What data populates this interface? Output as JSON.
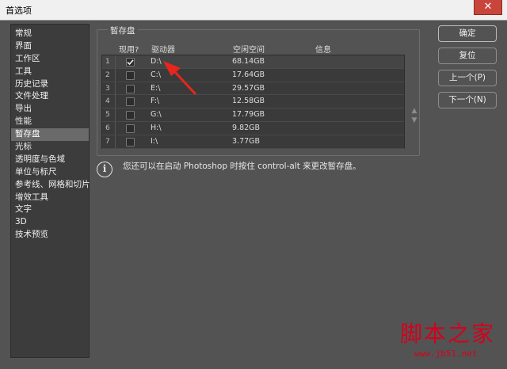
{
  "window": {
    "title": "首选项",
    "close_glyph": "✕"
  },
  "sidebar": {
    "items": [
      "常规",
      "界面",
      "工作区",
      "工具",
      "历史记录",
      "文件处理",
      "导出",
      "性能",
      "暂存盘",
      "光标",
      "透明度与色域",
      "单位与标尺",
      "参考线、网格和切片",
      "增效工具",
      "文字",
      "3D",
      "技术预览"
    ],
    "selected_index": 8
  },
  "scratch": {
    "group_title": "暂存盘",
    "columns": {
      "active": "现用?",
      "drive": "驱动器",
      "free_space": "空闲空间",
      "info": "信息"
    },
    "rows": [
      {
        "num": "1",
        "checked": true,
        "drive": "D:\\",
        "space": "68.14GB"
      },
      {
        "num": "2",
        "checked": false,
        "drive": "C:\\",
        "space": "17.64GB"
      },
      {
        "num": "3",
        "checked": false,
        "drive": "E:\\",
        "space": "29.57GB"
      },
      {
        "num": "4",
        "checked": false,
        "drive": "F:\\",
        "space": "12.58GB"
      },
      {
        "num": "5",
        "checked": false,
        "drive": "G:\\",
        "space": "17.79GB"
      },
      {
        "num": "6",
        "checked": false,
        "drive": "H:\\",
        "space": "9.82GB"
      },
      {
        "num": "7",
        "checked": false,
        "drive": "I:\\",
        "space": "3.77GB"
      }
    ],
    "move_up_glyph": "▲",
    "move_down_glyph": "▼",
    "info_glyph": "i",
    "info_text": "您还可以在启动 Photoshop 时按住 control-alt 来更改暂存盘。"
  },
  "buttons": {
    "ok": "确定",
    "reset": "复位",
    "prev": "上一个(P)",
    "next": "下一个(N)"
  },
  "watermark": {
    "text": "脚本之家",
    "url": "www.jb51.net"
  },
  "colors": {
    "annotation_arrow": "#e8261c",
    "watermark": "#d6001c",
    "selected_item": "#6a6a6a"
  },
  "icons": {
    "close": "close-icon",
    "info": "info-icon",
    "up": "triangle-up-icon",
    "down": "triangle-down-icon",
    "check": "checkmark-icon"
  }
}
